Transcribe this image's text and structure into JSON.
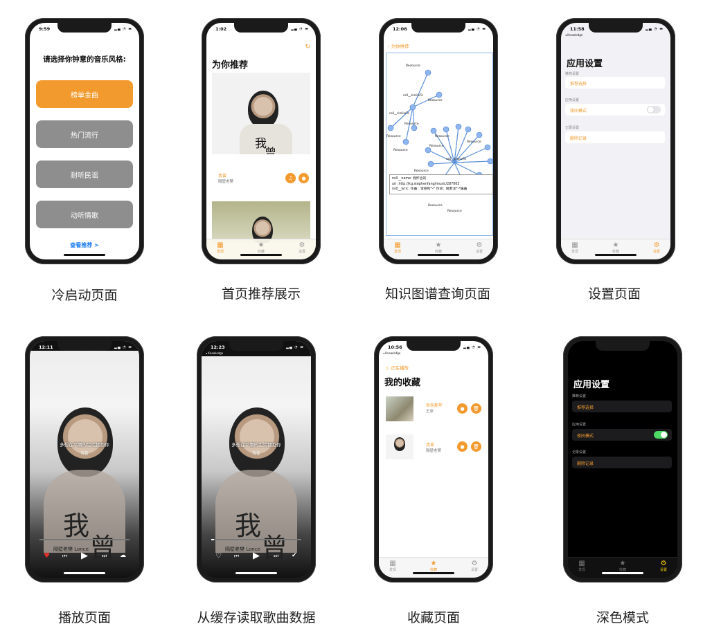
{
  "colors": {
    "accent": "#f39a2e",
    "gray_button": "#8e8e8e",
    "dark_bg": "#000000",
    "switch_on": "#4cd964"
  },
  "captions": [
    "冷启动页面",
    "首页推荐展示",
    "知识图谱查询页面",
    "设置页面",
    "播放页面",
    "从缓存读取歌曲数据",
    "收藏页面",
    "深色模式"
  ],
  "tabs": {
    "discover": "发现",
    "favorites": "收藏",
    "settings": "设置"
  },
  "p1": {
    "time": "9:59",
    "title": "请选择你钟意的音乐风格:",
    "styles": [
      "榜单金曲",
      "热门流行",
      "耐听民谣",
      "动听情歌"
    ],
    "view": "查看推荐 >"
  },
  "p2": {
    "time": "1:02",
    "title": "为你推荐",
    "song": "我曾",
    "artist": "隔壁老樊",
    "cover_big": "我",
    "cover_big2": "曾",
    "cover_small": "隔壁老樊 Lonce"
  },
  "p3": {
    "time": "12:06",
    "back": "为你推荐",
    "nodes": [
      "Resource",
      "Resource",
      "Resource",
      "Resource",
      "Resource",
      "Resource",
      "Resource",
      "Resource",
      "Resource",
      "Resource",
      "Resource"
    ],
    "edges": [
      "ns0__similarTo",
      "ns0__similarTo",
      "ns0__similarTo"
    ],
    "tooltip": [
      "ns0__name: 我怀念的",
      "uri: http://kg.stephenfang/music/287063",
      "ns0__lyric: 作曲：李德和*-* 作词：姚若龙*-*编曲"
    ]
  },
  "p4": {
    "time": "11:58",
    "back": "Knowledge",
    "title": "应用设置",
    "sections": [
      "推荐设置",
      "应用设置",
      "记录设置"
    ],
    "cells": [
      "推荐选择",
      "夜间模式",
      "删除记录"
    ]
  },
  "p5": {
    "time": "12:11",
    "lyric": "多想在平庸的生活拥抱你",
    "sub": "我曾",
    "cover_big": "我",
    "cover_big2": "曾",
    "cover_small": "隔壁老樊 Lonce",
    "progress": 0.0
  },
  "p6": {
    "time": "12:23",
    "back": "Knowledge",
    "lyric": "多想在平庸的生活拥抱你",
    "sub": "我曾",
    "cover_big": "我",
    "cover_big2": "曾",
    "cover_small": "隔壁老樊 Lonce",
    "progress": 0.03
  },
  "p7": {
    "time": "10:56",
    "back": "Knowledge",
    "now_playing": "正在播放",
    "title": "我的收藏",
    "items": [
      {
        "song": "匆匆那年",
        "artist": "王菲"
      },
      {
        "song": "我曾",
        "artist": "隔壁老樊"
      }
    ]
  },
  "p8": {
    "title": "应用设置",
    "sections": [
      "推荐设置",
      "应用设置",
      "记录设置"
    ],
    "cells": [
      "推荐选择",
      "夜间模式",
      "删除记录"
    ]
  }
}
